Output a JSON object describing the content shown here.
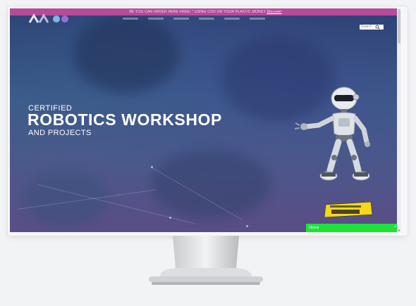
{
  "promo": {
    "text": "BE YOU CAN ORDER HERE FREE! * USING COD OR YOUR PLASTIC MONEY",
    "link": "Discover"
  },
  "search": {
    "placeholder": "Search"
  },
  "hero": {
    "line1": "CERTIFIED",
    "title": "ROBOTICS WORKSHOP",
    "line3": "AND PROJECTS"
  },
  "chat": {
    "label": "Online",
    "toggle": "^"
  },
  "colors": {
    "promo_bar": "#b64a9b",
    "chat_bar": "#1ee13a",
    "badge_yellow": "#f4d81b"
  },
  "icons": [
    "search-icon",
    "robot-illustration",
    "chevron-up-icon"
  ]
}
